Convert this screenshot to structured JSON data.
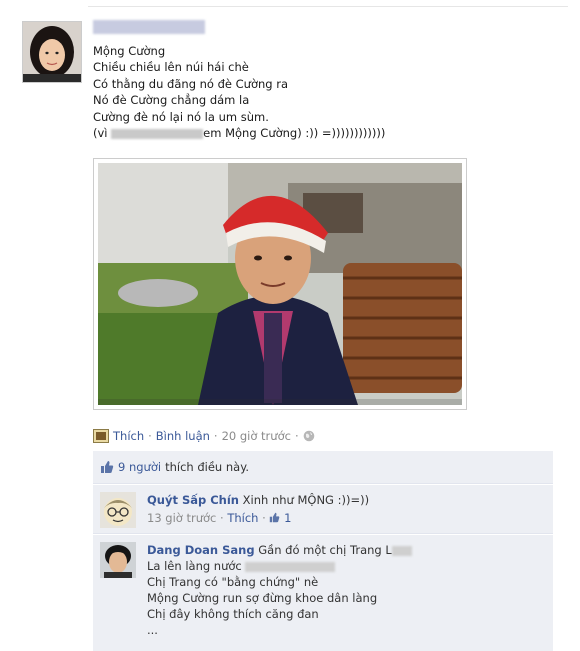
{
  "post": {
    "lines": [
      "Mộng Cường",
      "Chiều chiều lên núi hái chè",
      "Có thằng du đãng nó đè Cường ra",
      "Nó đè Cường chẳng dám la",
      "Cường đè nó lại nó la um sùm."
    ],
    "last_line_prefix": "(vì",
    "last_line_suffix": "em Mộng Cường) :)) =))))))))))))"
  },
  "actions": {
    "like": "Thích",
    "comment": "Bình luận",
    "sep": "·",
    "time": "20 giờ trước"
  },
  "likes": {
    "count": "9 người",
    "text": "thích điều này."
  },
  "comments": [
    {
      "author": "Quýt Sấp Chín",
      "text": "Xinh như MỘNG :))=))",
      "time": "13 giờ trước",
      "like": "Thích",
      "like_count": "1"
    },
    {
      "author": "Dang Doan Sang",
      "first_line": "Gần đó một chị Trang L",
      "lines_2_prefix": "La lên làng nước",
      "lines": [
        "Chị Trang có \"bằng chứng\" nè",
        "Mộng Cường run sợ đừng khoe dân làng",
        "Chị đây không thích căng đan",
        "..."
      ]
    }
  ],
  "colors": {
    "link": "#3b5998",
    "comment_bg": "#edeff4",
    "muted": "#8a8a8a"
  }
}
